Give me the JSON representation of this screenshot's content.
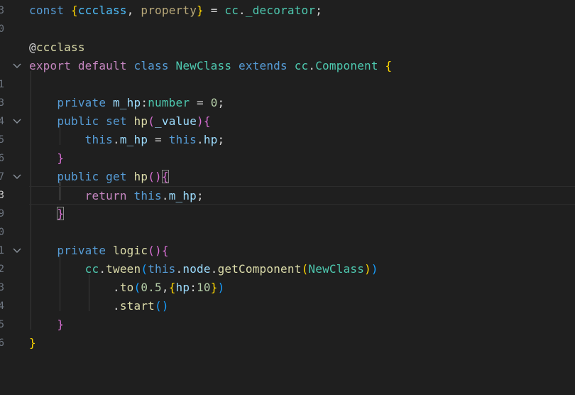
{
  "editor": {
    "colors": {
      "background": "#1f1f1f",
      "keyword": "#569cd6",
      "control": "#c586c0",
      "identifier": "#9cdcfe",
      "function": "#dcdcaa",
      "type": "#4ec9b0",
      "number": "#b5cea8",
      "plain": "#d4d4d4",
      "bracket_gold": "#ffd700",
      "bracket_pink": "#da70d6",
      "bracket_blue": "#179fff",
      "line_number": "#6e7681"
    },
    "gutter": {
      "line_numbers": [
        "3",
        "0",
        "",
        "",
        "1",
        "3",
        "4",
        "5",
        "6",
        "7",
        "3",
        "9",
        "0",
        "1",
        "2",
        "3",
        "4",
        "5",
        "6",
        ""
      ],
      "active_line_number_index": 10,
      "fold_icon": "chevron-down-icon",
      "fold_lines": [
        3,
        6,
        9,
        13
      ]
    },
    "lines": [
      [
        [
          "const ",
          "#569cd6"
        ],
        [
          "{",
          "#ffd700"
        ],
        [
          "ccclass",
          "#4fc1ff"
        ],
        [
          ", ",
          "#d4d4d4"
        ],
        [
          "property",
          "#b8a879"
        ],
        [
          "}",
          "#ffd700"
        ],
        [
          " = ",
          "#d4d4d4"
        ],
        [
          "cc",
          "#4ec9b0"
        ],
        [
          ".",
          "#d4d4d4"
        ],
        [
          "_decorator",
          "#4ec9b0"
        ],
        [
          ";",
          "#d4d4d4"
        ]
      ],
      [],
      [
        [
          "@",
          "#d4d4d4"
        ],
        [
          "ccclass",
          "#dcdcaa"
        ]
      ],
      [
        [
          "export ",
          "#c586c0"
        ],
        [
          "default ",
          "#c586c0"
        ],
        [
          "class ",
          "#569cd6"
        ],
        [
          "NewClass ",
          "#4ec9b0"
        ],
        [
          "extends ",
          "#569cd6"
        ],
        [
          "cc",
          "#4ec9b0"
        ],
        [
          ".",
          "#d4d4d4"
        ],
        [
          "Component ",
          "#4ec9b0"
        ],
        [
          "{",
          "#ffd700"
        ]
      ],
      [],
      [
        [
          "    private ",
          "#569cd6"
        ],
        [
          "m_hp",
          "#9cdcfe"
        ],
        [
          ":",
          "#d4d4d4"
        ],
        [
          "number",
          "#4ec9b0"
        ],
        [
          " = ",
          "#d4d4d4"
        ],
        [
          "0",
          "#b5cea8"
        ],
        [
          ";",
          "#d4d4d4"
        ]
      ],
      [
        [
          "    public ",
          "#569cd6"
        ],
        [
          "set ",
          "#569cd6"
        ],
        [
          "hp",
          "#dcdcaa"
        ],
        [
          "(",
          "#da70d6"
        ],
        [
          "_value",
          "#9cdcfe"
        ],
        [
          ")",
          "#da70d6"
        ],
        [
          "{",
          "#da70d6"
        ]
      ],
      [
        [
          "        this",
          "#569cd6"
        ],
        [
          ".",
          "#d4d4d4"
        ],
        [
          "m_hp",
          "#9cdcfe"
        ],
        [
          " = ",
          "#d4d4d4"
        ],
        [
          "this",
          "#569cd6"
        ],
        [
          ".",
          "#d4d4d4"
        ],
        [
          "hp",
          "#9cdcfe"
        ],
        [
          ";",
          "#d4d4d4"
        ]
      ],
      [
        [
          "    }",
          "#da70d6"
        ]
      ],
      [
        [
          "    public ",
          "#569cd6"
        ],
        [
          "get ",
          "#569cd6"
        ],
        [
          "hp",
          "#dcdcaa"
        ],
        [
          "(",
          "#da70d6"
        ],
        [
          ")",
          "#da70d6"
        ],
        [
          "{",
          "#da70d6"
        ]
      ],
      [
        [
          "        return ",
          "#c586c0"
        ],
        [
          "this",
          "#569cd6"
        ],
        [
          ".",
          "#d4d4d4"
        ],
        [
          "m_hp",
          "#9cdcfe"
        ],
        [
          ";",
          "#d4d4d4"
        ]
      ],
      [
        [
          "    }",
          "#da70d6"
        ]
      ],
      [],
      [
        [
          "    private ",
          "#569cd6"
        ],
        [
          "logic",
          "#dcdcaa"
        ],
        [
          "(",
          "#da70d6"
        ],
        [
          ")",
          "#da70d6"
        ],
        [
          "{",
          "#da70d6"
        ]
      ],
      [
        [
          "        cc",
          "#4ec9b0"
        ],
        [
          ".",
          "#d4d4d4"
        ],
        [
          "tween",
          "#dcdcaa"
        ],
        [
          "(",
          "#179fff"
        ],
        [
          "this",
          "#569cd6"
        ],
        [
          ".",
          "#d4d4d4"
        ],
        [
          "node",
          "#9cdcfe"
        ],
        [
          ".",
          "#d4d4d4"
        ],
        [
          "getComponent",
          "#dcdcaa"
        ],
        [
          "(",
          "#ffd700"
        ],
        [
          "NewClass",
          "#4ec9b0"
        ],
        [
          ")",
          "#ffd700"
        ],
        [
          ")",
          "#179fff"
        ]
      ],
      [
        [
          "            .",
          "#d4d4d4"
        ],
        [
          "to",
          "#dcdcaa"
        ],
        [
          "(",
          "#179fff"
        ],
        [
          "0.5",
          "#b5cea8"
        ],
        [
          ",",
          "#d4d4d4"
        ],
        [
          "{",
          "#ffd700"
        ],
        [
          "hp",
          "#9cdcfe"
        ],
        [
          ":",
          "#d4d4d4"
        ],
        [
          "10",
          "#b5cea8"
        ],
        [
          "}",
          "#ffd700"
        ],
        [
          ")",
          "#179fff"
        ]
      ],
      [
        [
          "            .",
          "#d4d4d4"
        ],
        [
          "start",
          "#dcdcaa"
        ],
        [
          "(",
          "#179fff"
        ],
        [
          ")",
          "#179fff"
        ]
      ],
      [
        [
          "    }",
          "#da70d6"
        ]
      ],
      [
        [
          "}",
          "#ffd700"
        ]
      ],
      []
    ],
    "current_line_index": 10
  }
}
